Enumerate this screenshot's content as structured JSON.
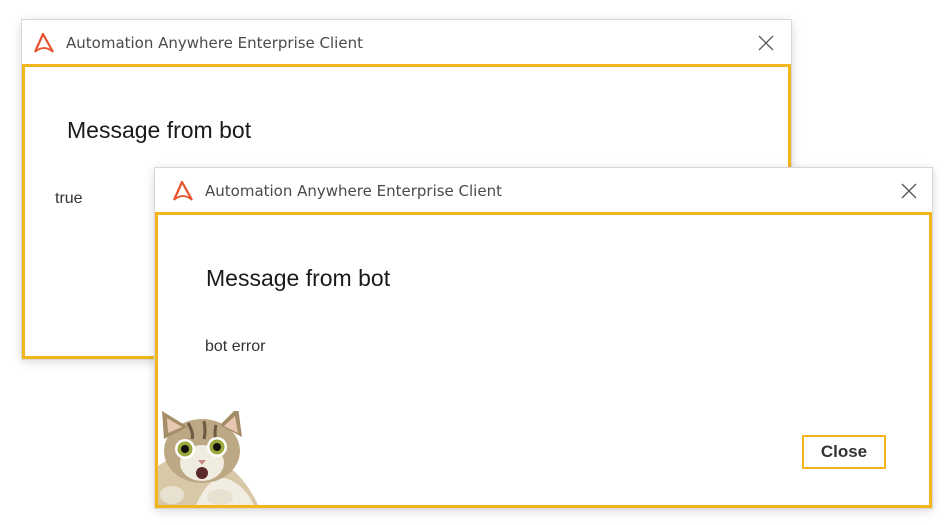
{
  "back_dialog": {
    "window_title": "Automation Anywhere Enterprise Client",
    "heading": "Message from bot",
    "message": "true"
  },
  "front_dialog": {
    "window_title": "Automation Anywhere Enterprise Client",
    "heading": "Message from bot",
    "message": "bot error",
    "close_button_label": "Close"
  },
  "icons": {
    "logo": "automation-anywhere-logo-icon",
    "close": "close-icon",
    "sticker": "surprised-cat-sticker"
  },
  "colors": {
    "accent": "#f2b51c",
    "logo": "#e8522d"
  }
}
